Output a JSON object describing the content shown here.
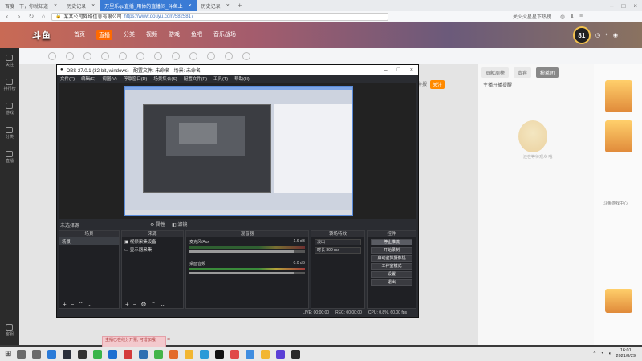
{
  "browser": {
    "tabs": [
      {
        "label": "百度一下，你就知道"
      },
      {
        "label": "历史记录"
      },
      {
        "label": "万里乐qu直播_用体的直播间_斗鱼上",
        "active": true
      },
      {
        "label": "历史记录"
      }
    ],
    "url_prefix": "某某公司网络信息有限公司",
    "url": "https://www.douyu.com/5825817",
    "news": "关火火星星下热榜"
  },
  "site": {
    "logo": "斗鱼",
    "nav": [
      "首页",
      "直播",
      "分类",
      "视频",
      "游戏",
      "鱼吧",
      "音乐战场"
    ],
    "nav_highlight_index": 1,
    "level": "81"
  },
  "room": {
    "follow_text": "关注",
    "tabs": [
      "贡献周榜",
      "贵宾",
      "粉丝团"
    ],
    "guide_text": "新人福利",
    "mascot_caption": "还在等待观众 哦",
    "pc_label": "PC客户端",
    "subscribe_label": "主播开播提醒",
    "side_labels": [
      "斗鱼游戏中心"
    ],
    "report": "举报"
  },
  "left_sidebar": {
    "items": [
      "关注",
      "排行榜",
      "游戏",
      "分类",
      "直播"
    ],
    "bottom": "客服"
  },
  "obs": {
    "title": "OBS 27.0.1 (32-bit, windows) - 配置文件: 未命名 - 场景: 未命名",
    "menu": [
      "文件(F)",
      "编辑(E)",
      "视图(V)",
      "停靠窗口(D)",
      "场景集合(S)",
      "配置文件(P)",
      "工具(T)",
      "帮助(H)"
    ],
    "scene_label": "未选择源",
    "properties_label": "属性",
    "filters_label": "滤镜",
    "docks": {
      "scenes": {
        "title": "场景",
        "items": [
          "场景"
        ]
      },
      "sources": {
        "title": "来源",
        "items": [
          "视频采集设备",
          "显示器采集"
        ]
      },
      "mixer": {
        "title": "混音器",
        "tracks": [
          {
            "name": "麦克风/Aux",
            "db": "-1.6 dB"
          },
          {
            "name": "桌面音频",
            "db": "0.0 dB"
          }
        ]
      },
      "transitions": {
        "title": "转场特效",
        "type": "淡出",
        "duration_label": "时长",
        "duration": "300 ms"
      },
      "controls": {
        "title": "控件",
        "buttons": [
          "停止推流",
          "开始录制",
          "启动虚拟摄像机",
          "工作室模式",
          "设置",
          "退出"
        ]
      }
    },
    "status": {
      "live": "LIVE: 00:00:00",
      "rec": "REC: 00:00:00",
      "cpu": "CPU: 0.8%, 60.00 fps"
    }
  },
  "toast": {
    "text": "主播已在线分开票, 可增加哦!"
  },
  "taskbar": {
    "icons": [
      "search",
      "task-view",
      "browser",
      "steam",
      "obs",
      "chat",
      "store",
      "game",
      "mail",
      "wechat",
      "photo",
      "folder",
      "music",
      "qq",
      "app",
      "app2",
      "app3",
      "app4",
      "app5"
    ],
    "icon_colors": [
      "#6a6a6a",
      "#6a6a6a",
      "#2b7bd8",
      "#2a2f3a",
      "#333",
      "#39b54a",
      "#1d6fd1",
      "#d43c3c",
      "#2f6fb2",
      "#44b549",
      "#e36b2b",
      "#f2b632",
      "#2b9ad8",
      "#111",
      "#e04848",
      "#3f8de0",
      "#f2b632",
      "#5b3fd6",
      "#2a2a2a"
    ],
    "time": "16:01",
    "date": "2021/8/29"
  }
}
